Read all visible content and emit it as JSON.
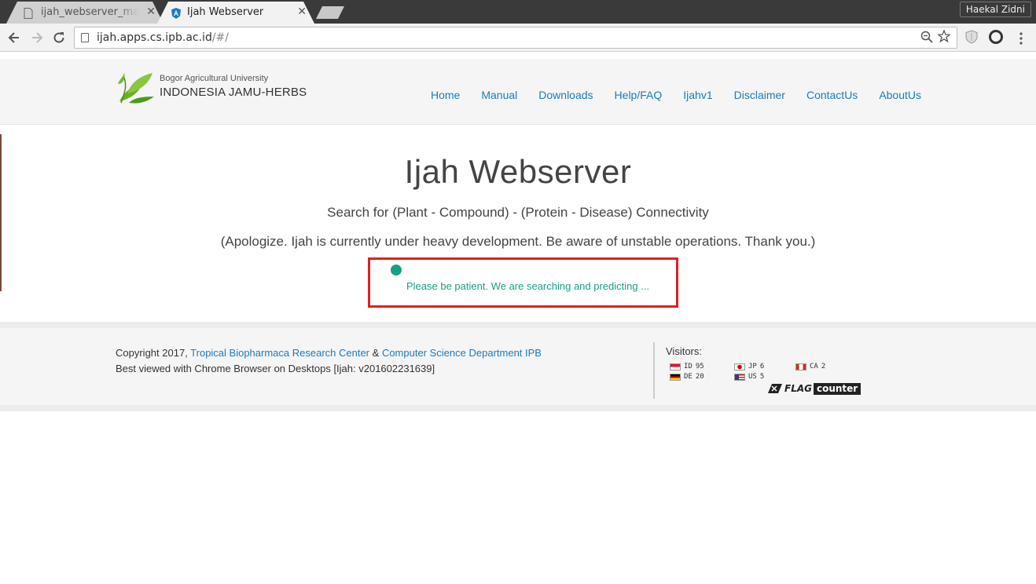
{
  "browser": {
    "tabs": [
      {
        "title": "ijah_webserver_manual",
        "active": false
      },
      {
        "title": "Ijah Webserver",
        "active": true
      }
    ],
    "profile_name": "Haekal Zidni",
    "url_host": "ijah.apps.cs.ipb.ac.id",
    "url_path": "/#/",
    "close_glyph": "✕"
  },
  "brand": {
    "subtitle": "Bogor Agricultural University",
    "title": "INDONESIA JAMU-HERBS"
  },
  "nav": {
    "items": [
      "Home",
      "Manual",
      "Downloads",
      "Help/FAQ",
      "Ijahv1",
      "Disclaimer",
      "ContactUs",
      "AboutUs"
    ]
  },
  "hero": {
    "title": "Ijah Webserver",
    "subtitle": "Search for (Plant - Compound) - (Protein - Disease) Connectivity",
    "note": "(Apologize. Ijah is currently under heavy development. Be aware of unstable operations. Thank you.)"
  },
  "status": {
    "message": "Please be patient. We are searching and predicting ...",
    "color": "#16a085",
    "highlight_color": "#e02020"
  },
  "footer": {
    "copyright_prefix": "Copyright 2017,",
    "org1": "Tropical Biopharmaca Research Center",
    "amp": "&",
    "org2": "Computer Science Department IPB",
    "line2": "Best viewed with Chrome Browser on Desktops [Ijah: v201602231639]",
    "visitors_label": "Visitors:",
    "flag_counts": [
      {
        "code": "ID",
        "count": "95"
      },
      {
        "code": "JP",
        "count": "6"
      },
      {
        "code": "CA",
        "count": "2"
      },
      {
        "code": "DE",
        "count": "20"
      },
      {
        "code": "US",
        "count": "5"
      }
    ],
    "flagcounter_left": "FLAG",
    "flagcounter_right": "counter"
  },
  "colors": {
    "link": "#1a7cc1",
    "brand_green": "#6ab023"
  }
}
